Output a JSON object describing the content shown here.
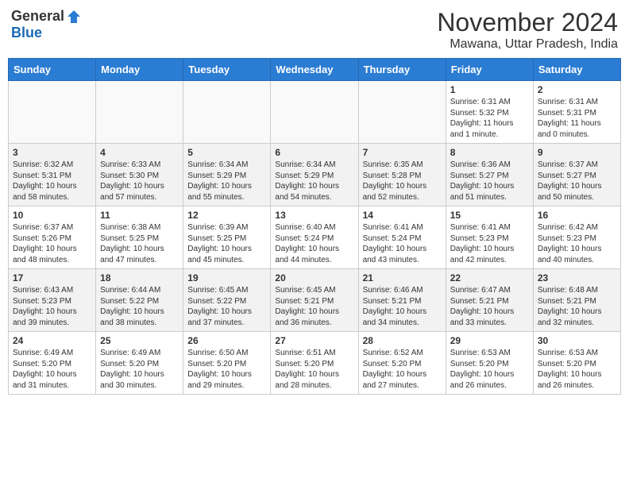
{
  "header": {
    "logo_general": "General",
    "logo_blue": "Blue",
    "month_title": "November 2024",
    "location": "Mawana, Uttar Pradesh, India"
  },
  "days_of_week": [
    "Sunday",
    "Monday",
    "Tuesday",
    "Wednesday",
    "Thursday",
    "Friday",
    "Saturday"
  ],
  "weeks": [
    [
      {
        "day": "",
        "info": ""
      },
      {
        "day": "",
        "info": ""
      },
      {
        "day": "",
        "info": ""
      },
      {
        "day": "",
        "info": ""
      },
      {
        "day": "",
        "info": ""
      },
      {
        "day": "1",
        "info": "Sunrise: 6:31 AM\nSunset: 5:32 PM\nDaylight: 11 hours\nand 1 minute."
      },
      {
        "day": "2",
        "info": "Sunrise: 6:31 AM\nSunset: 5:31 PM\nDaylight: 11 hours\nand 0 minutes."
      }
    ],
    [
      {
        "day": "3",
        "info": "Sunrise: 6:32 AM\nSunset: 5:31 PM\nDaylight: 10 hours\nand 58 minutes."
      },
      {
        "day": "4",
        "info": "Sunrise: 6:33 AM\nSunset: 5:30 PM\nDaylight: 10 hours\nand 57 minutes."
      },
      {
        "day": "5",
        "info": "Sunrise: 6:34 AM\nSunset: 5:29 PM\nDaylight: 10 hours\nand 55 minutes."
      },
      {
        "day": "6",
        "info": "Sunrise: 6:34 AM\nSunset: 5:29 PM\nDaylight: 10 hours\nand 54 minutes."
      },
      {
        "day": "7",
        "info": "Sunrise: 6:35 AM\nSunset: 5:28 PM\nDaylight: 10 hours\nand 52 minutes."
      },
      {
        "day": "8",
        "info": "Sunrise: 6:36 AM\nSunset: 5:27 PM\nDaylight: 10 hours\nand 51 minutes."
      },
      {
        "day": "9",
        "info": "Sunrise: 6:37 AM\nSunset: 5:27 PM\nDaylight: 10 hours\nand 50 minutes."
      }
    ],
    [
      {
        "day": "10",
        "info": "Sunrise: 6:37 AM\nSunset: 5:26 PM\nDaylight: 10 hours\nand 48 minutes."
      },
      {
        "day": "11",
        "info": "Sunrise: 6:38 AM\nSunset: 5:25 PM\nDaylight: 10 hours\nand 47 minutes."
      },
      {
        "day": "12",
        "info": "Sunrise: 6:39 AM\nSunset: 5:25 PM\nDaylight: 10 hours\nand 45 minutes."
      },
      {
        "day": "13",
        "info": "Sunrise: 6:40 AM\nSunset: 5:24 PM\nDaylight: 10 hours\nand 44 minutes."
      },
      {
        "day": "14",
        "info": "Sunrise: 6:41 AM\nSunset: 5:24 PM\nDaylight: 10 hours\nand 43 minutes."
      },
      {
        "day": "15",
        "info": "Sunrise: 6:41 AM\nSunset: 5:23 PM\nDaylight: 10 hours\nand 42 minutes."
      },
      {
        "day": "16",
        "info": "Sunrise: 6:42 AM\nSunset: 5:23 PM\nDaylight: 10 hours\nand 40 minutes."
      }
    ],
    [
      {
        "day": "17",
        "info": "Sunrise: 6:43 AM\nSunset: 5:23 PM\nDaylight: 10 hours\nand 39 minutes."
      },
      {
        "day": "18",
        "info": "Sunrise: 6:44 AM\nSunset: 5:22 PM\nDaylight: 10 hours\nand 38 minutes."
      },
      {
        "day": "19",
        "info": "Sunrise: 6:45 AM\nSunset: 5:22 PM\nDaylight: 10 hours\nand 37 minutes."
      },
      {
        "day": "20",
        "info": "Sunrise: 6:45 AM\nSunset: 5:21 PM\nDaylight: 10 hours\nand 36 minutes."
      },
      {
        "day": "21",
        "info": "Sunrise: 6:46 AM\nSunset: 5:21 PM\nDaylight: 10 hours\nand 34 minutes."
      },
      {
        "day": "22",
        "info": "Sunrise: 6:47 AM\nSunset: 5:21 PM\nDaylight: 10 hours\nand 33 minutes."
      },
      {
        "day": "23",
        "info": "Sunrise: 6:48 AM\nSunset: 5:21 PM\nDaylight: 10 hours\nand 32 minutes."
      }
    ],
    [
      {
        "day": "24",
        "info": "Sunrise: 6:49 AM\nSunset: 5:20 PM\nDaylight: 10 hours\nand 31 minutes."
      },
      {
        "day": "25",
        "info": "Sunrise: 6:49 AM\nSunset: 5:20 PM\nDaylight: 10 hours\nand 30 minutes."
      },
      {
        "day": "26",
        "info": "Sunrise: 6:50 AM\nSunset: 5:20 PM\nDaylight: 10 hours\nand 29 minutes."
      },
      {
        "day": "27",
        "info": "Sunrise: 6:51 AM\nSunset: 5:20 PM\nDaylight: 10 hours\nand 28 minutes."
      },
      {
        "day": "28",
        "info": "Sunrise: 6:52 AM\nSunset: 5:20 PM\nDaylight: 10 hours\nand 27 minutes."
      },
      {
        "day": "29",
        "info": "Sunrise: 6:53 AM\nSunset: 5:20 PM\nDaylight: 10 hours\nand 26 minutes."
      },
      {
        "day": "30",
        "info": "Sunrise: 6:53 AM\nSunset: 5:20 PM\nDaylight: 10 hours\nand 26 minutes."
      }
    ]
  ]
}
